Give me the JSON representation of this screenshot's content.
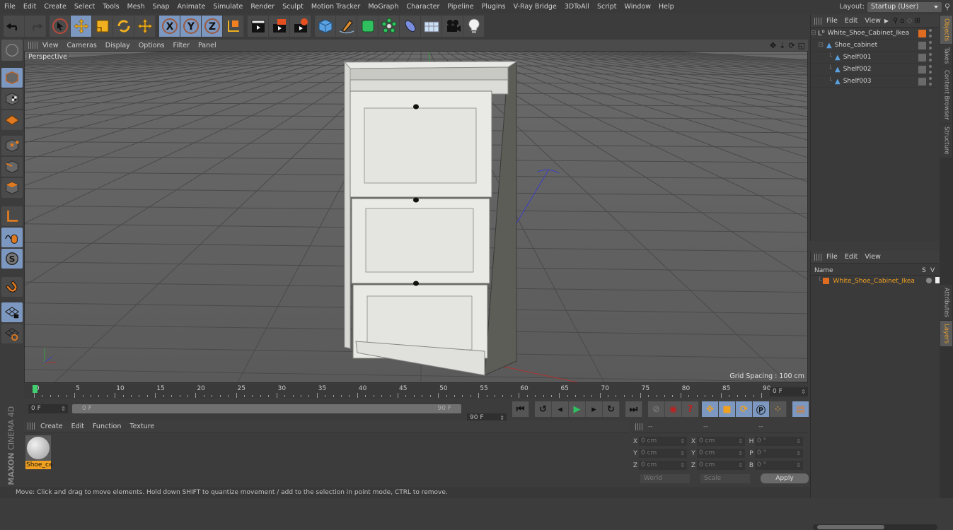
{
  "menubar": [
    "File",
    "Edit",
    "Create",
    "Select",
    "Tools",
    "Mesh",
    "Snap",
    "Animate",
    "Simulate",
    "Render",
    "Sculpt",
    "Motion Tracker",
    "MoGraph",
    "Character",
    "Pipeline",
    "Plugins",
    "V-Ray Bridge",
    "3DToAll",
    "Script",
    "Window",
    "Help"
  ],
  "layout": {
    "label": "Layout:",
    "value": "Startup (User)"
  },
  "toolbar": {
    "icons": [
      "undo-icon",
      "redo-icon",
      "live-selection-icon",
      "move-icon",
      "scale-icon",
      "rotate-icon",
      "recent-tool-icon",
      "x-axis-icon",
      "y-axis-icon",
      "z-axis-icon",
      "coordinate-system-icon",
      "render-view-icon",
      "render-picture-viewer-icon",
      "render-settings-icon",
      "cube-icon",
      "pen-spline-icon",
      "subdivision-icon",
      "cloner-icon",
      "deformer-icon",
      "floor-icon",
      "camera-icon",
      "light-icon"
    ]
  },
  "viewport": {
    "menu": [
      "View",
      "Cameras",
      "Display",
      "Options",
      "Filter",
      "Panel"
    ],
    "label": "Perspective",
    "grid_spacing": "Grid Spacing : 100 cm"
  },
  "left_tools": [
    "model-mode-icon",
    "texture-mode-icon",
    "workplane-icon",
    "points-mode-icon",
    "edges-mode-icon",
    "polygons-mode-icon",
    "axis-mode-icon",
    "tweak-mode-icon",
    "solo-icon",
    "snap-icon",
    "lock-workplane-icon",
    "planar-workplane-icon"
  ],
  "timeline": {
    "ticks": [
      "0",
      "5",
      "10",
      "15",
      "20",
      "25",
      "30",
      "35",
      "40",
      "45",
      "50",
      "55",
      "60",
      "65",
      "70",
      "75",
      "80",
      "85",
      "90"
    ],
    "current_frame": "0 F",
    "start_field": "0 F",
    "range_start": "0 F",
    "range_end": "90 F",
    "end_field": "90 F",
    "progress": 0
  },
  "material_panel": {
    "menu": [
      "Create",
      "Edit",
      "Function",
      "Texture"
    ],
    "materials": [
      {
        "name": "Shoe_ca"
      }
    ]
  },
  "coordinates": {
    "headers": [
      "--",
      "--",
      "--"
    ],
    "rows": [
      {
        "l1": "X",
        "v1": "0 cm",
        "l2": "X",
        "v2": "0 cm",
        "l3": "H",
        "v3": "0 °"
      },
      {
        "l1": "Y",
        "v1": "0 cm",
        "l2": "Y",
        "v2": "0 cm",
        "l3": "P",
        "v3": "0 °"
      },
      {
        "l1": "Z",
        "v1": "0 cm",
        "l2": "Z",
        "v2": "0 cm",
        "l3": "B",
        "v3": "0 °"
      }
    ],
    "mode": "World",
    "transform": "Scale",
    "apply": "Apply"
  },
  "status": "Move: Click and drag to move elements. Hold down SHIFT to quantize movement / add to the selection in point mode, CTRL to remove.",
  "objects_panel": {
    "menu": [
      "File",
      "Edit",
      "View"
    ],
    "items": [
      {
        "name": "White_Shoe_Cabinet_Ikea",
        "level": 0,
        "type": "null",
        "tag_color": "#e06c22"
      },
      {
        "name": "Shoe_cabinet",
        "level": 1,
        "type": "polygon"
      },
      {
        "name": "Shelf001",
        "level": 2,
        "type": "polygon"
      },
      {
        "name": "Shelf002",
        "level": 2,
        "type": "polygon"
      },
      {
        "name": "Shelf003",
        "level": 2,
        "type": "polygon"
      }
    ]
  },
  "layers_panel": {
    "menu": [
      "File",
      "Edit",
      "View"
    ],
    "columns": [
      "Name",
      "S",
      "V"
    ],
    "items": [
      {
        "name": "White_Shoe_Cabinet_Ikea",
        "color": "#e06c22"
      }
    ]
  },
  "side_tabs": [
    {
      "label": "Objects",
      "active": true
    },
    {
      "label": "Takes",
      "active": false
    },
    {
      "label": "Content Browser",
      "active": false
    },
    {
      "label": "Structure",
      "active": false
    },
    {
      "label": "Attributes",
      "active": false
    },
    {
      "label": "Layers",
      "active": true
    }
  ],
  "branding": {
    "line1": "MAXON",
    "line2": "CINEMA 4D"
  },
  "colors": {
    "accent": "#7d98c0",
    "orange": "#e8a030",
    "viewport_bg": "#626262"
  }
}
